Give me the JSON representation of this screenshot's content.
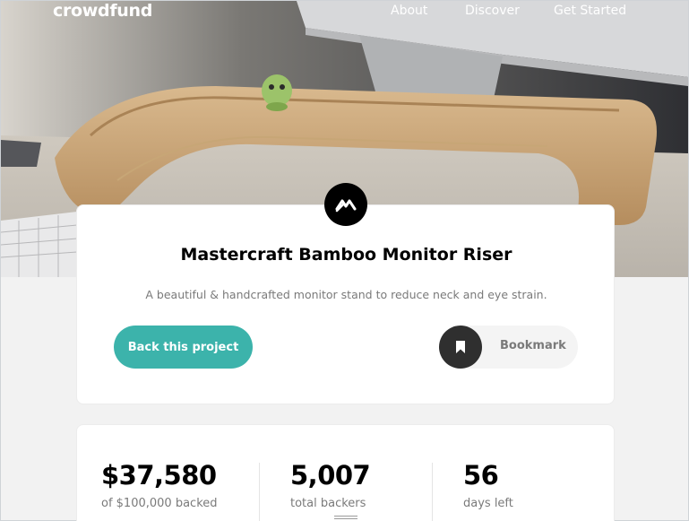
{
  "nav": {
    "logo": "crowdfund",
    "links": [
      "About",
      "Discover",
      "Get Started"
    ]
  },
  "project": {
    "title": "Mastercraft Bamboo Monitor Riser",
    "description": "A beautiful & handcrafted monitor stand to reduce neck and eye strain.",
    "back_label": "Back this project",
    "bookmark_label": "Bookmark"
  },
  "stats": [
    {
      "value": "$37,580",
      "label": "of $100,000 backed"
    },
    {
      "value": "5,007",
      "label": "total backers"
    },
    {
      "value": "56",
      "label": "days left"
    }
  ],
  "colors": {
    "accent": "#3cb3ab",
    "dark": "#2f2f2f",
    "muted_text": "#7a7a7a"
  },
  "icons": {
    "brand": "mastercraft-logo-icon",
    "bookmark": "bookmark-icon"
  }
}
